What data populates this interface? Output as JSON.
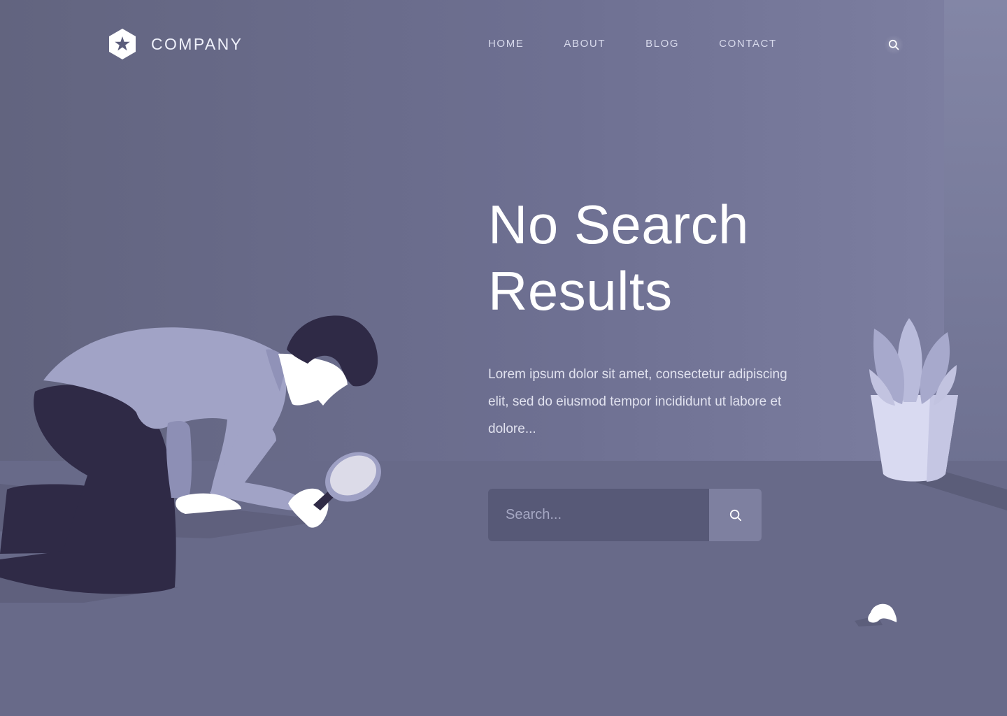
{
  "brand": {
    "name": "COMPANY",
    "logo_icon": "star-hexagon-icon"
  },
  "nav": {
    "items": [
      {
        "label": "HOME"
      },
      {
        "label": "ABOUT"
      },
      {
        "label": "BLOG"
      },
      {
        "label": "CONTACT"
      }
    ],
    "search_icon": "search-icon"
  },
  "hero": {
    "title_line1": "No Search",
    "title_line2": "Results",
    "description": "Lorem ipsum dolor sit amet, consectetur adipiscing elit, sed do eiusmod tempor incididunt ut labore et dolore..."
  },
  "search": {
    "placeholder": "Search...",
    "value": "",
    "button_icon": "search-icon"
  },
  "colors": {
    "background": "#686a8a",
    "wall": "#6e7092",
    "search_input_bg": "#575977",
    "search_button_bg": "#7e80a0",
    "text_primary": "#ffffff",
    "text_secondary": "#e1e2ef",
    "illustration_dark": "#302b48",
    "illustration_light": "#a3a5c8"
  }
}
